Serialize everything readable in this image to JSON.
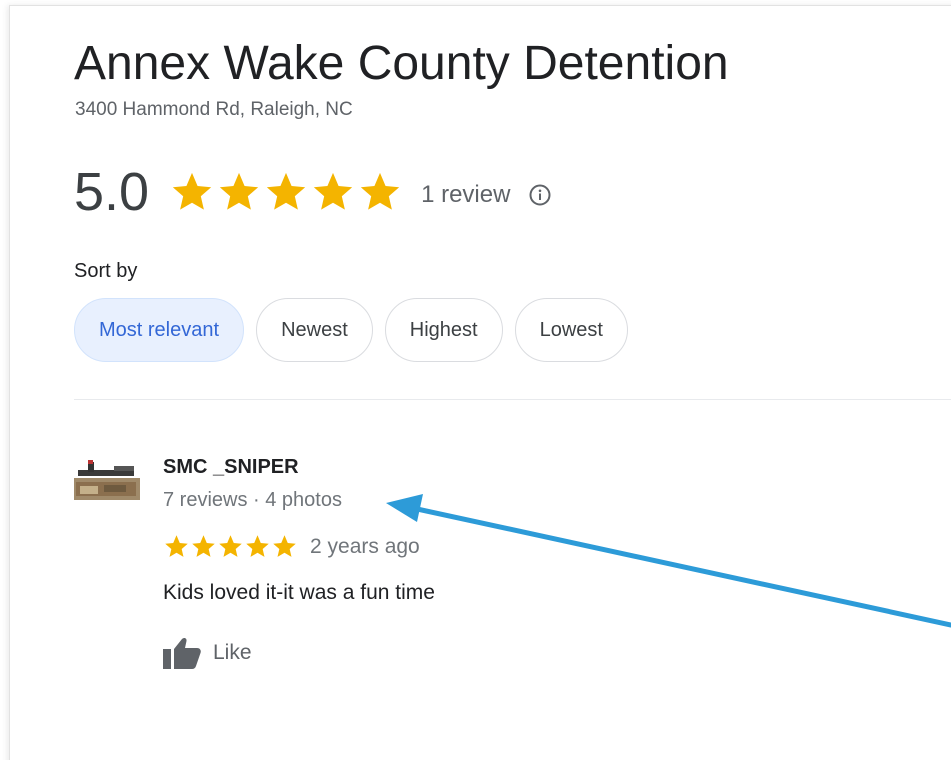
{
  "place": {
    "title": "Annex Wake County Detention",
    "address": "3400 Hammond Rd, Raleigh, NC"
  },
  "rating": {
    "value": "5.0",
    "stars": 5,
    "review_count": "1 review",
    "info_icon": "info-icon",
    "star_color": "#f4b400"
  },
  "sort": {
    "label": "Sort by",
    "options": [
      "Most relevant",
      "Newest",
      "Highest",
      "Lowest"
    ],
    "selected": "Most relevant"
  },
  "review": {
    "reviewer": "SMC _SNIPER",
    "meta": "7 reviews · 4 photos",
    "stars": 5,
    "date": "2 years ago",
    "text": "Kids loved it-it was a fun time",
    "like_label": "Like"
  },
  "colors": {
    "accent_blue": "#3367d6",
    "selected_chip_bg": "#e8f0fe",
    "arrow": "#2d9bd8"
  }
}
